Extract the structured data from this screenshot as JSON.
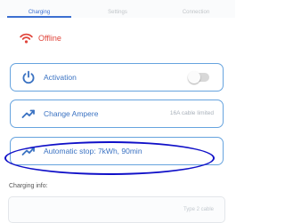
{
  "tabs": [
    {
      "label": "Charging",
      "active": true
    },
    {
      "label": "Settings",
      "active": false
    },
    {
      "label": "Connection",
      "active": false
    }
  ],
  "status": {
    "text": "Offline",
    "color": "#e0463c",
    "icon": "wifi-icon"
  },
  "cards": {
    "activation": {
      "label": "Activation",
      "icon": "power-icon",
      "toggle_on": false
    },
    "ampere": {
      "label": "Change Ampere",
      "detail": "16A cable limited",
      "icon": "trend-up-icon"
    },
    "stop": {
      "label": "Automatic stop: 7kWh, 90min",
      "icon": "trend-up-icon"
    }
  },
  "charging_info": {
    "heading": "Charging info:",
    "value": "Type 2 cable"
  },
  "colors": {
    "accent": "#3b6fd1",
    "card_border": "#66a3de",
    "offline": "#e0463c",
    "annotation": "#1010c8"
  }
}
